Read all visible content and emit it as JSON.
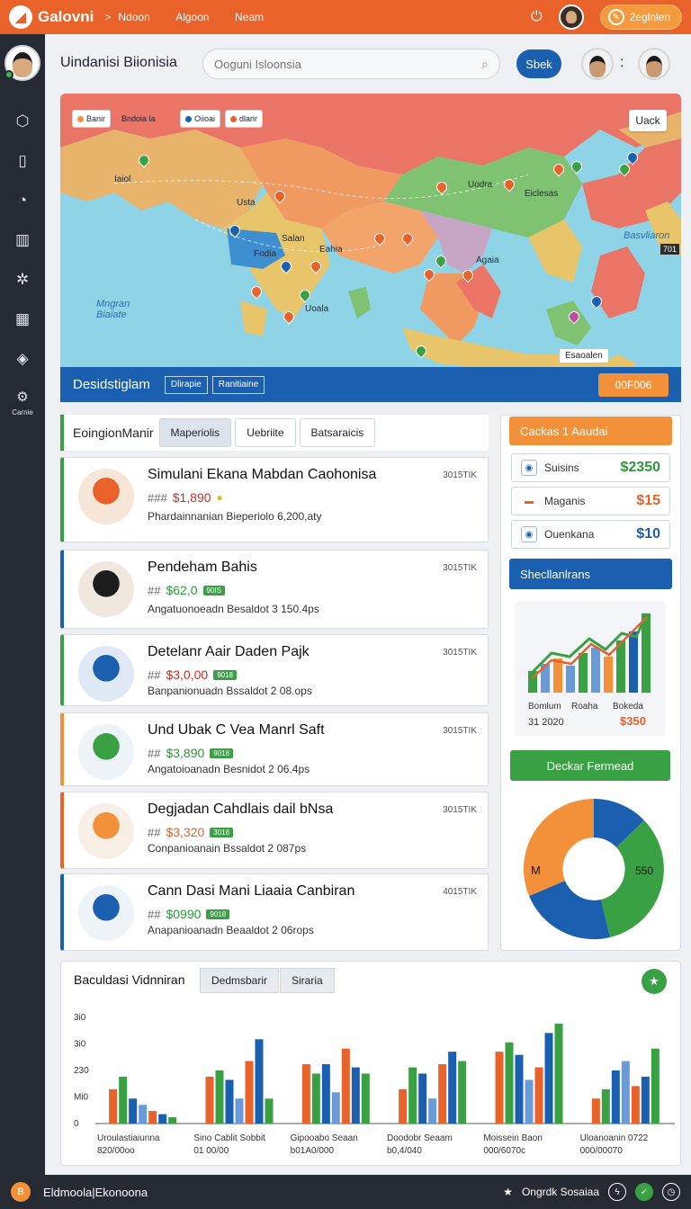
{
  "topbar": {
    "logo_glyph": "◢",
    "brand": "Galovni",
    "sep": ">",
    "nav": [
      "Ndoon",
      "Algoon",
      "Neam"
    ],
    "bulb_icon": "lightbulb-icon",
    "upgrade_label": "2eglnlen"
  },
  "sidebar": {
    "icons": [
      "shield-icon",
      "terminal-icon",
      "clock-icon",
      "book-icon",
      "gear-icon",
      "building-icon",
      "shield-check-icon"
    ],
    "bottom_icon": "settings-icon",
    "bottom_label": "Carnie"
  },
  "header": {
    "title": "Uindanisi Biionisia",
    "search_placeholder": "Ooguni Isloonsia",
    "search_button": "Sbek",
    "dots": ":"
  },
  "map": {
    "chips": [
      {
        "label": "Banir",
        "color": "#f2913a"
      },
      {
        "label": "Bndoia la",
        "color": "#e8622a"
      },
      {
        "label": "Oiioai",
        "color": "#1a5fb0"
      },
      {
        "label": "dlarir",
        "color": "#e8622a"
      }
    ],
    "top_button": "Uack",
    "labels": [
      {
        "text": "Iaiol",
        "sea": false
      },
      {
        "text": "Usta",
        "sea": false
      },
      {
        "text": "Salan",
        "sea": false
      },
      {
        "text": "Eahia",
        "sea": false
      },
      {
        "text": "Fodia",
        "sea": false
      },
      {
        "text": "Uoala",
        "sea": false
      },
      {
        "text": "Uodra",
        "sea": false
      },
      {
        "text": "Eiclesas",
        "sea": false
      },
      {
        "text": "Agaia",
        "sea": false
      },
      {
        "text": "Mngran\nBiaiate",
        "sea": true
      },
      {
        "text": "Basvliaron",
        "sea": true
      }
    ],
    "corner_tag": "701",
    "footer_tag": "Esaoalen",
    "bar": {
      "title": "Desidstiglam",
      "tabs": [
        "Dlirapie",
        "Ranitiaine"
      ],
      "pill": "00F006"
    }
  },
  "feed": {
    "title": "EoingionManir",
    "tabs": [
      "Maperiolis",
      "Uebriite",
      "Batsaraicis"
    ],
    "items": [
      {
        "title": "Simulani Ekana Mabdan Caohonisa",
        "tag": "3015TIK",
        "hash": "###",
        "price": "$1,890",
        "price_color": "#c4302b",
        "badge": "",
        "sub": "Phardainnanian Bieperiolo 6,200,aty",
        "accent": "#3aa044"
      },
      {
        "title": "Pendeham Bahis",
        "tag": "3015TIK",
        "hash": "##",
        "price": "$62,0",
        "price_color": "#2a9a3a",
        "badge": "90IS",
        "sub": "Angatuonoeadn Besaldot 3 150.4ps",
        "accent": "#1a5fb0"
      },
      {
        "title": "Detelanr Aair Daden Pajk",
        "tag": "3015TIK",
        "hash": "##",
        "price": "$3,0,00",
        "price_color": "#c4302b",
        "badge": "9018",
        "sub": "Banpanionuadn Bssaldot 2 08.ops",
        "accent": "#3aa044"
      },
      {
        "title": "Und Ubak C Vea Manrl Saft",
        "tag": "3015TIK",
        "hash": "##",
        "price": "$3,890",
        "price_color": "#2a9a3a",
        "badge": "9018",
        "sub": "Angatoioanadn Besnidot 2 06.4ps",
        "accent": "#f2913a"
      },
      {
        "title": "Degjadan Cahdlais dail bNsa",
        "tag": "3015TIK",
        "hash": "##",
        "price": "$3,320",
        "price_color": "#e8622a",
        "badge": "3018",
        "sub": "Conpanioanain Bssaldot 2 087ps",
        "accent": "#e8622a"
      },
      {
        "title": "Cann Dasi Mani Liaaia Canbiran",
        "tag": "4015TIK",
        "hash": "##",
        "price": "$0990",
        "price_color": "#2a9a3a",
        "badge": "9018",
        "sub": "Anapanioanadn Beaaldot 2 06rops",
        "accent": "#1a5fb0"
      }
    ]
  },
  "stats": {
    "head": "Cackas 1 Aaudai",
    "rows": [
      {
        "icon": "target-icon",
        "label": "Suisins",
        "value": "$2350",
        "color": "#2a9a3a"
      },
      {
        "icon": "flag-icon",
        "label": "Maganis",
        "value": "$15",
        "color": "#e8622a"
      },
      {
        "icon": "target-icon",
        "label": "Ouenkana",
        "value": "$10",
        "color": "#1a5fb0"
      }
    ],
    "section_title": "Shecllanlrans",
    "mini_chart": {
      "left": "Bomlum",
      "mid": "Roaha",
      "right": "Bokeda",
      "date": "31 2020",
      "value": "$350"
    },
    "button": "Deckar Fermead",
    "donut": {
      "left_label": "M",
      "right_label": "550"
    }
  },
  "bottom": {
    "title": "Baculdasi Vidnniran",
    "tabs": [
      "Dedmsbarir",
      "Siraria"
    ]
  },
  "chart_data": {
    "type": "bar",
    "title": "Baculdasi Vidnniran",
    "xlabel": "",
    "ylabel": "",
    "yticks": [
      "0",
      "Mi0",
      "230",
      "3i0",
      "3i0"
    ],
    "categories": [
      "Uroulastiaiunna\n820/00oo",
      "Sino Cablit Sobbit\n01 00/00",
      "Gipooabo Seaan\nb01A0/000",
      "Doodobr Seaam\nb0,4/040",
      "Moissein Baon\n000/6070c",
      "Uloanoanin 0722\n000/00070"
    ],
    "series": [
      {
        "color": "#e8622a",
        "values": [
          55,
          75,
          95,
          55,
          115,
          40
        ]
      },
      {
        "color": "#3aa044",
        "values": [
          75,
          85,
          80,
          90,
          130,
          55
        ]
      },
      {
        "color": "#1a5fb0",
        "values": [
          40,
          70,
          95,
          80,
          110,
          85
        ]
      },
      {
        "color": "#6a9ad8",
        "values": [
          30,
          40,
          50,
          40,
          70,
          100
        ]
      },
      {
        "color": "#e8622a",
        "values": [
          20,
          100,
          120,
          95,
          90,
          60
        ]
      },
      {
        "color": "#1a5fb0",
        "values": [
          15,
          135,
          90,
          115,
          145,
          75
        ]
      },
      {
        "color": "#3aa044",
        "values": [
          10,
          40,
          80,
          100,
          160,
          120
        ]
      }
    ],
    "ylim": [
      0,
      170
    ],
    "grid": false,
    "legend": "none"
  },
  "footer": {
    "logo": "B",
    "text": "Eldmoola|Ekonoona",
    "right_label": "Ongrdk Sosaiaa",
    "icons": [
      "star-icon",
      "bolt-icon",
      "check-icon",
      "clock-icon"
    ]
  }
}
